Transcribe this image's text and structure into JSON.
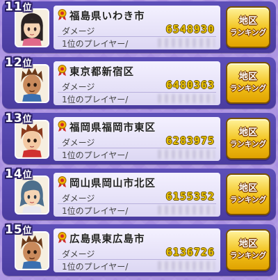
{
  "labels": {
    "damage": "ダメージ",
    "top_player": "1位のプレイヤー/",
    "button_line1": "地区",
    "button_line2": "ランキング"
  },
  "entries": [
    {
      "rank": "11",
      "rank_suffix": "位",
      "region": "福島県いわき市",
      "score": "6548930",
      "avatar": "girl-black-hair",
      "hair_color": "#2a2222"
    },
    {
      "rank": "12",
      "rank_suffix": "位",
      "region": "東京都新宿区",
      "score": "6480363",
      "avatar": "boy-brown-hair",
      "hair_color": "#6b3a1a"
    },
    {
      "rank": "13",
      "rank_suffix": "位",
      "region": "福岡県福岡市東区",
      "score": "6283975",
      "avatar": "boy-red-hair",
      "hair_color": "#8a3a1c"
    },
    {
      "rank": "14",
      "rank_suffix": "位",
      "region": "岡山県岡山市北区",
      "score": "6155352",
      "avatar": "girl-blue-hair",
      "hair_color": "#4d6f8c"
    },
    {
      "rank": "15",
      "rank_suffix": "位",
      "region": "広島県東広島市",
      "score": "6136726",
      "avatar": "boy-brown-hair",
      "hair_color": "#6b3a1a"
    }
  ],
  "colors": {
    "background": "#a98fe0",
    "row": "#4a3c9f",
    "score": "#e8c000",
    "button": "#f2c21b"
  }
}
